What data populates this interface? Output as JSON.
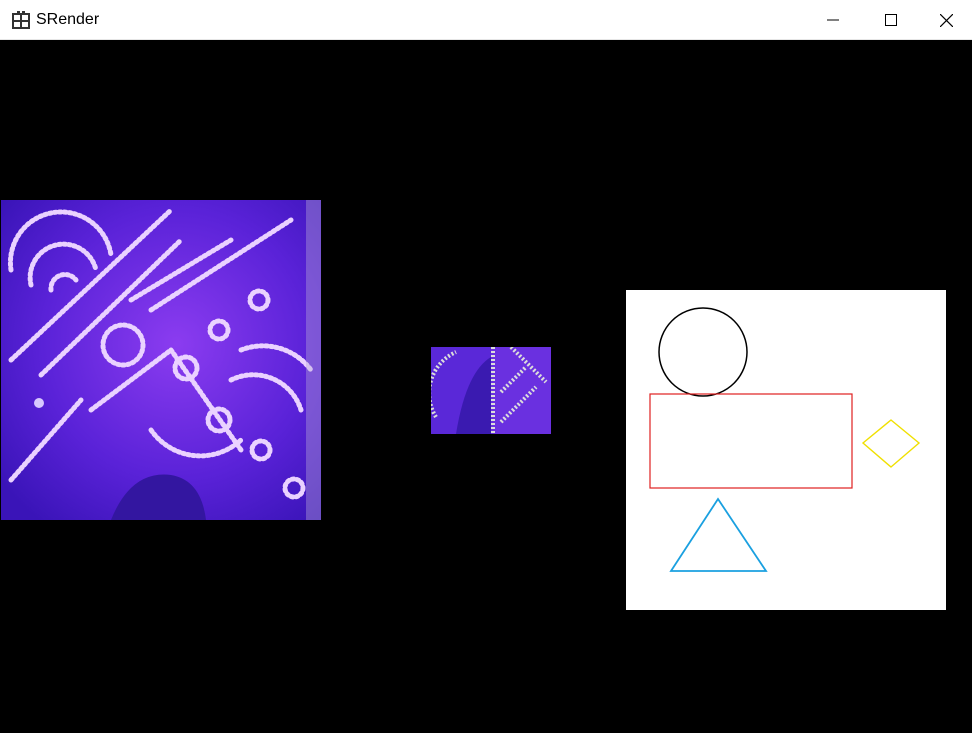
{
  "window": {
    "title": "SRender",
    "icon": "app-grid-icon",
    "controls": {
      "minimize_icon": "minimize-icon",
      "maximize_icon": "maximize-icon",
      "close_icon": "close-icon"
    }
  },
  "scene": {
    "background": "#000000",
    "textures": [
      {
        "name": "texture-quad-large",
        "palette": [
          "#4a1fd0",
          "#7a35e8",
          "#e8c8ff"
        ]
      },
      {
        "name": "texture-quad-small",
        "palette": [
          "#3d1ab8",
          "#6a2fd8",
          "#d9d9d9"
        ]
      }
    ],
    "shape_panel": {
      "background": "#ffffff",
      "shapes": [
        {
          "type": "circle",
          "color": "#000000"
        },
        {
          "type": "rectangle",
          "color": "#e02020"
        },
        {
          "type": "diamond",
          "color": "#f0e000"
        },
        {
          "type": "triangle",
          "color": "#1aa0e0"
        }
      ]
    }
  }
}
